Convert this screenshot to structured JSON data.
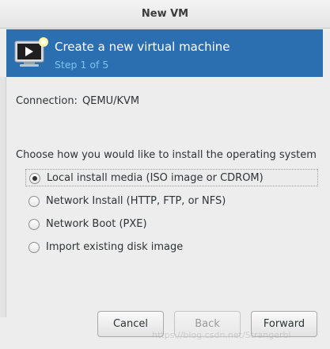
{
  "window": {
    "title": "New VM"
  },
  "banner": {
    "headline": "Create a new virtual machine",
    "step": "Step 1 of 5"
  },
  "connection": {
    "label": "Connection:",
    "value": "QEMU/KVM"
  },
  "install": {
    "prompt": "Choose how you would like to install the operating system",
    "selected_index": 0,
    "options": [
      "Local install media (ISO image or CDROM)",
      "Network Install (HTTP, FTP, or NFS)",
      "Network Boot (PXE)",
      "Import existing disk image"
    ]
  },
  "buttons": {
    "cancel": "Cancel",
    "back": "Back",
    "forward": "Forward"
  },
  "watermark": "https://blog.csdn.net/Strangerbi",
  "colors": {
    "banner": "#2b6fb1",
    "step_text": "#7ec3f0"
  }
}
